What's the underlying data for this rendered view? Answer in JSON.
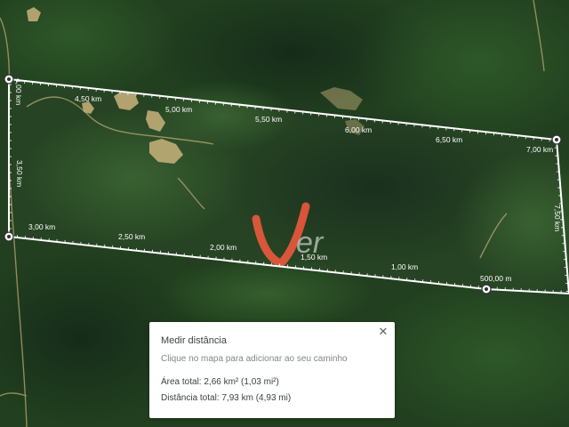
{
  "map": {
    "type": "satellite",
    "measure_line_color": "#ffffff",
    "vertex_color": "#ffffff",
    "watermark_color": "#e8553a",
    "distance_labels": [
      "4,00 km",
      "4,50 km",
      "5,00 km",
      "5,50 km",
      "6,00 km",
      "6,50 km",
      "7,00 km",
      "7,50 km",
      "500,00 m",
      "1,00 km",
      "1,50 km",
      "2,00 km",
      "2,50 km",
      "3,00 km",
      "3,50 km"
    ],
    "watermark": "Ver"
  },
  "measure_panel": {
    "title": "Medir distância",
    "hint": "Clique no mapa para adicionar ao seu caminho",
    "area_total": "Área total: 2,66 km² (1,03 mi²)",
    "distance_total": "Distância total: 7,93 km (4,93 mi)",
    "close_icon": "close-icon"
  }
}
